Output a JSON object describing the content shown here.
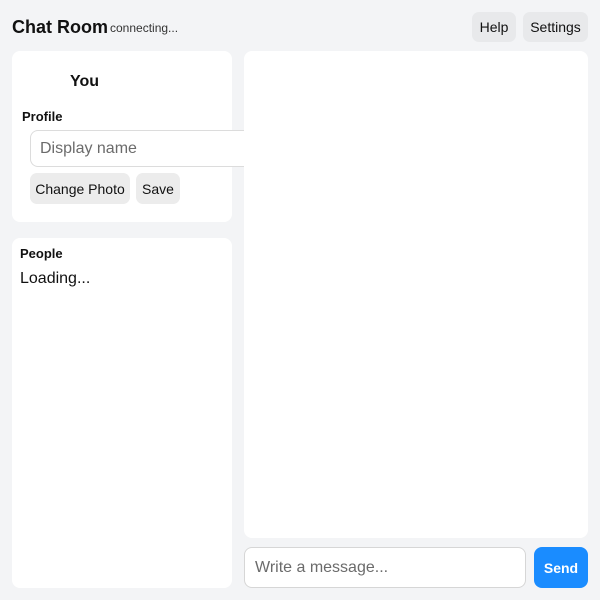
{
  "header": {
    "title": "Chat Room",
    "status": "connecting...",
    "help_label": "Help",
    "settings_label": "Settings"
  },
  "profile": {
    "you_label": "You",
    "heading": "Profile",
    "display_name_placeholder": "Display name",
    "display_name_value": "",
    "change_photo_label": "Change Photo",
    "save_label": "Save"
  },
  "people": {
    "heading": "People",
    "loading_text": "Loading..."
  },
  "composer": {
    "message_placeholder": "Write a message...",
    "message_value": "",
    "send_label": "Send"
  },
  "colors": {
    "background": "#f3f4f6",
    "panel": "#ffffff",
    "send_accent": "#1a8cff",
    "secondary_button": "#ececec"
  }
}
